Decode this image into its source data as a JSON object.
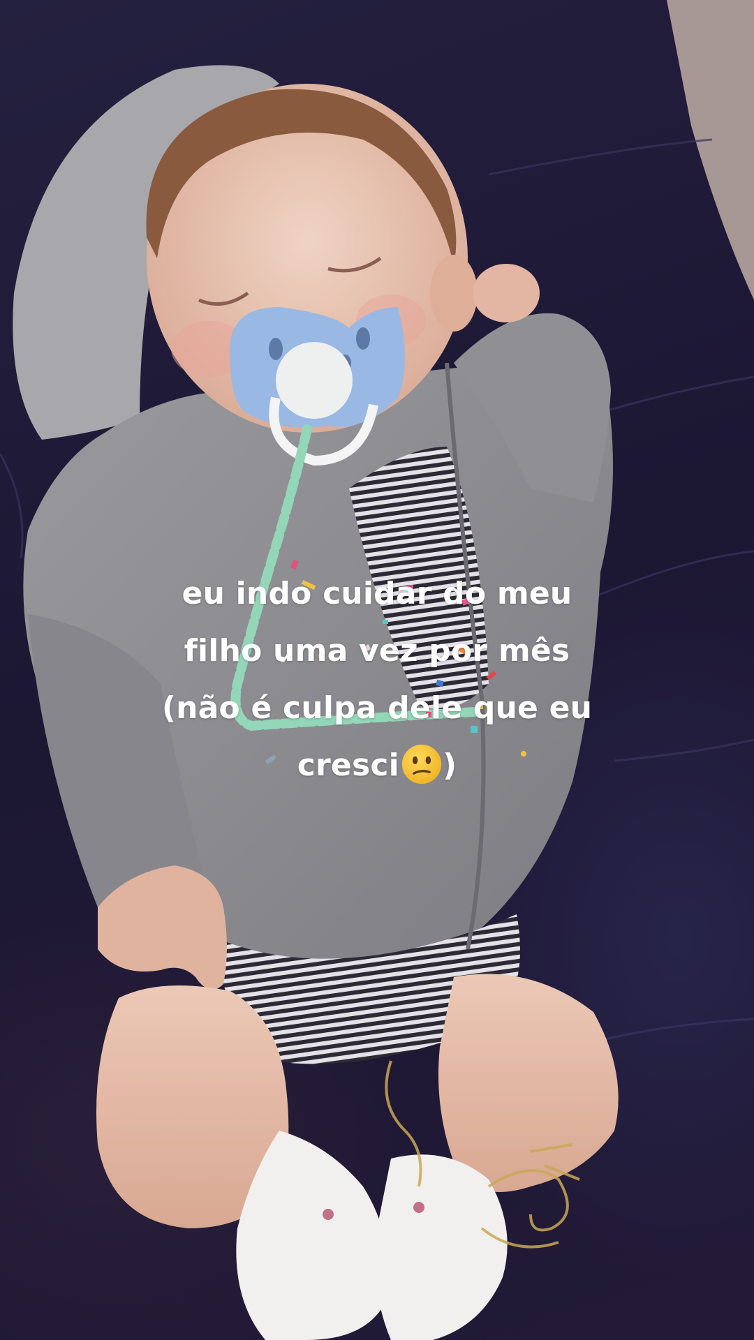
{
  "caption": {
    "line1": "eu indo cuidar do meu",
    "line2": "filho uma vez por mês",
    "line3": "(não é culpa dele que eu",
    "line4_text": "cresci",
    "line4_emoji": "confused-face-emoji",
    "line4_end": ")"
  },
  "scene": {
    "subject": "reborn-baby-doll",
    "icons": [
      "confused-face-emoji",
      "confetti"
    ]
  },
  "colors": {
    "blanket": "#1f1a38",
    "hoodie": "#8e8e92",
    "pacifier": "#9ab8e4",
    "pacifier_chain": "#93d6b8",
    "skin": "#e8c6b4",
    "socks": "#f2f0ee",
    "caption_text": "#ffffff",
    "emoji_face": "#f7c53a"
  }
}
